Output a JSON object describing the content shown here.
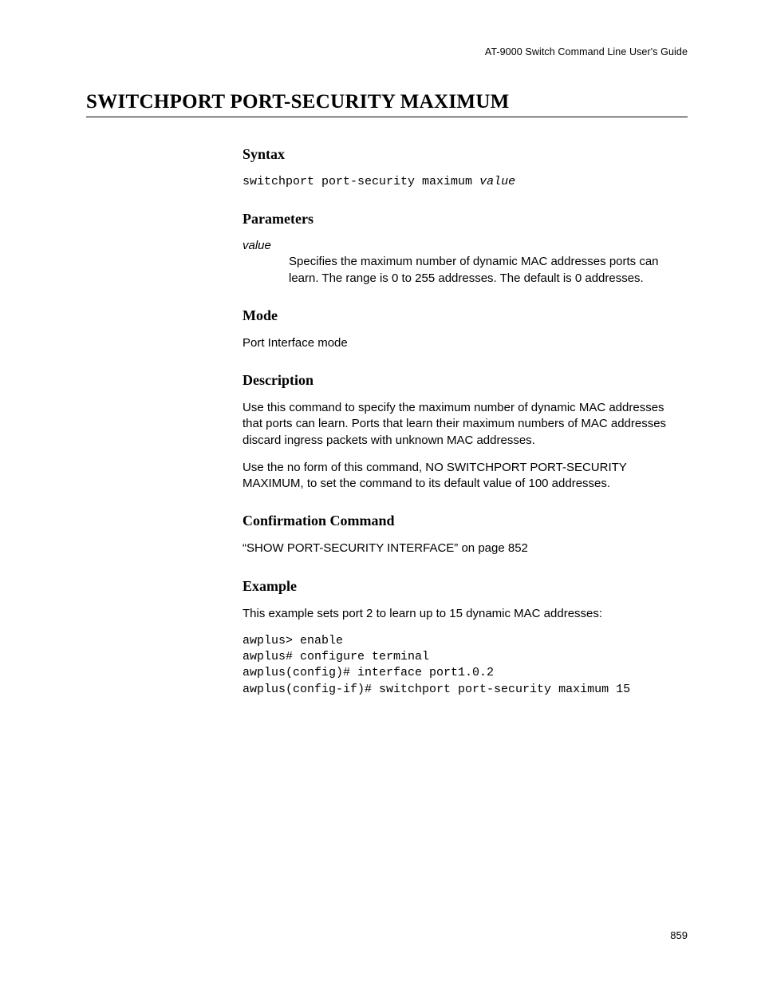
{
  "header": {
    "running_head": "AT-9000 Switch Command Line User's Guide"
  },
  "title": "SWITCHPORT PORT-SECURITY MAXIMUM",
  "sections": {
    "syntax": {
      "heading": "Syntax",
      "command": "switchport port-security maximum ",
      "arg": "value"
    },
    "parameters": {
      "heading": "Parameters",
      "term": "value",
      "desc": "Specifies the maximum number of dynamic MAC addresses ports can learn. The range is 0 to 255 addresses. The default is 0 addresses."
    },
    "mode": {
      "heading": "Mode",
      "text": "Port Interface mode"
    },
    "description": {
      "heading": "Description",
      "p1": "Use this command to specify the maximum number of dynamic MAC addresses that ports can learn. Ports that learn their maximum numbers of MAC addresses discard ingress packets with unknown MAC addresses.",
      "p2": "Use the no form of this command, NO SWITCHPORT PORT-SECURITY MAXIMUM, to set the command to its default value of 100 addresses."
    },
    "confirmation": {
      "heading": "Confirmation Command",
      "text": "“SHOW PORT-SECURITY INTERFACE” on page 852"
    },
    "example": {
      "heading": "Example",
      "intro": "This example sets port 2 to learn up to 15 dynamic MAC addresses:",
      "code": "awplus> enable\nawplus# configure terminal\nawplus(config)# interface port1.0.2\nawplus(config-if)# switchport port-security maximum 15"
    }
  },
  "page_number": "859"
}
